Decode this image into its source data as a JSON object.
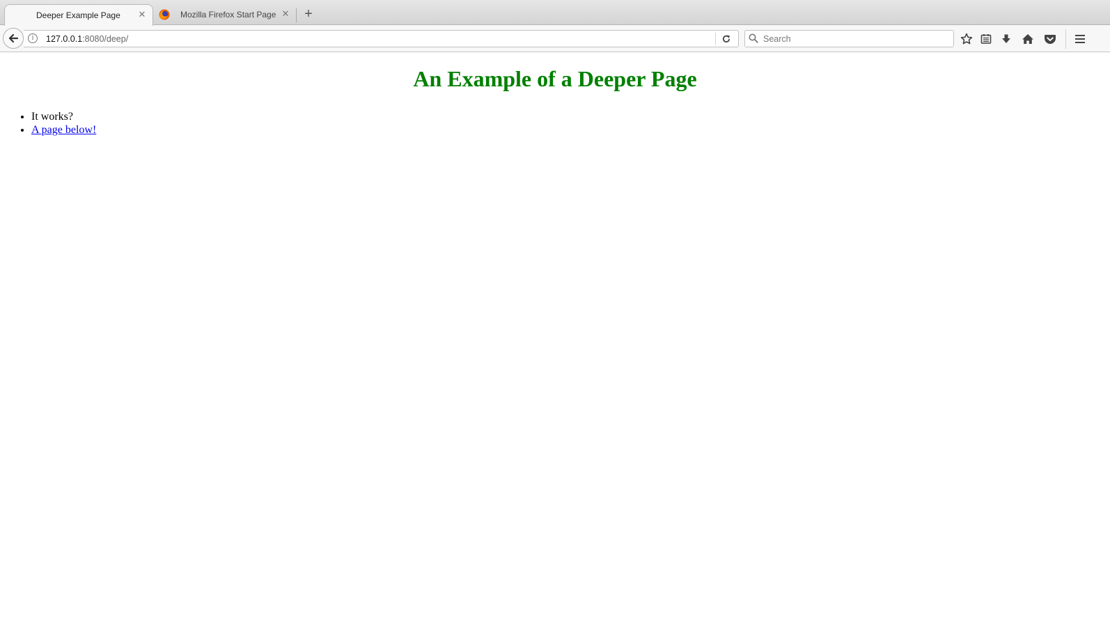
{
  "browser": {
    "tabs": [
      {
        "title": "Deeper Example Page",
        "active": true
      },
      {
        "title": "Mozilla Firefox Start Page",
        "active": false
      }
    ],
    "url": {
      "host": "127.0.0.1",
      "rest": ":8080/deep/"
    },
    "search": {
      "placeholder": "Search",
      "value": ""
    },
    "toolbar_icons": [
      "bookmark-star-icon",
      "reading-list-icon",
      "downloads-icon",
      "home-icon",
      "pocket-icon",
      "menu-icon"
    ]
  },
  "page": {
    "heading": "An Example of a Deeper Page",
    "heading_color": "#008000",
    "items": [
      {
        "text": "It works?"
      },
      {
        "text": "A page below!",
        "link": true
      }
    ],
    "link_color": "#0000ee"
  }
}
